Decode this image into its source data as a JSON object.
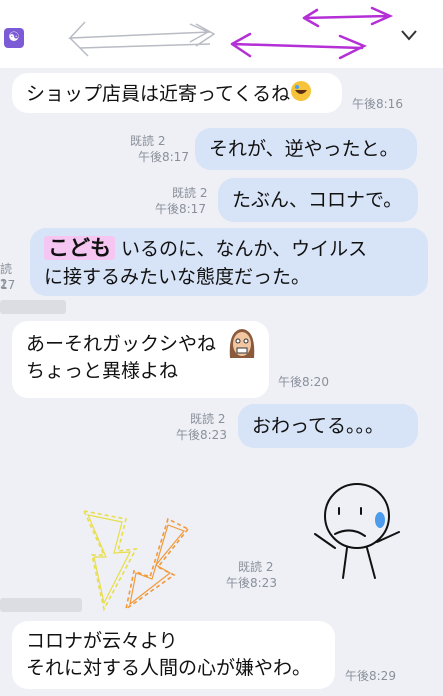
{
  "header": {
    "app_icon": "☯",
    "menu_icon": "chevron-down-icon"
  },
  "messages": [
    {
      "text": "ショップ店員は近寄ってくるね",
      "time": "午後8:16"
    },
    {
      "read": "既読 2",
      "time": "午後8:17",
      "text": "それが、逆やったと。"
    },
    {
      "read": "既読 2",
      "time": "午後8:17",
      "text": "たぶん、コロナで。"
    },
    {
      "highlight": "こども",
      "line1_rest": "いるのに、なんか、ウイルス",
      "line2": "に接するみたいな態度だった。",
      "partial_read": "読 2",
      "partial_time": "17"
    },
    {
      "line1": "あーそれガックシやね",
      "line2": "ちょっと異様よね",
      "time": "午後8:20"
    },
    {
      "read": "既読 2",
      "time": "午後8:23",
      "text": "おわってる。。。"
    },
    {
      "read": "既読 2",
      "time": "午後8:23"
    },
    {
      "line1": "コロナが云々より",
      "line2": "それに対する人間の心が嫌やわ。",
      "time": "午後8:29"
    }
  ]
}
